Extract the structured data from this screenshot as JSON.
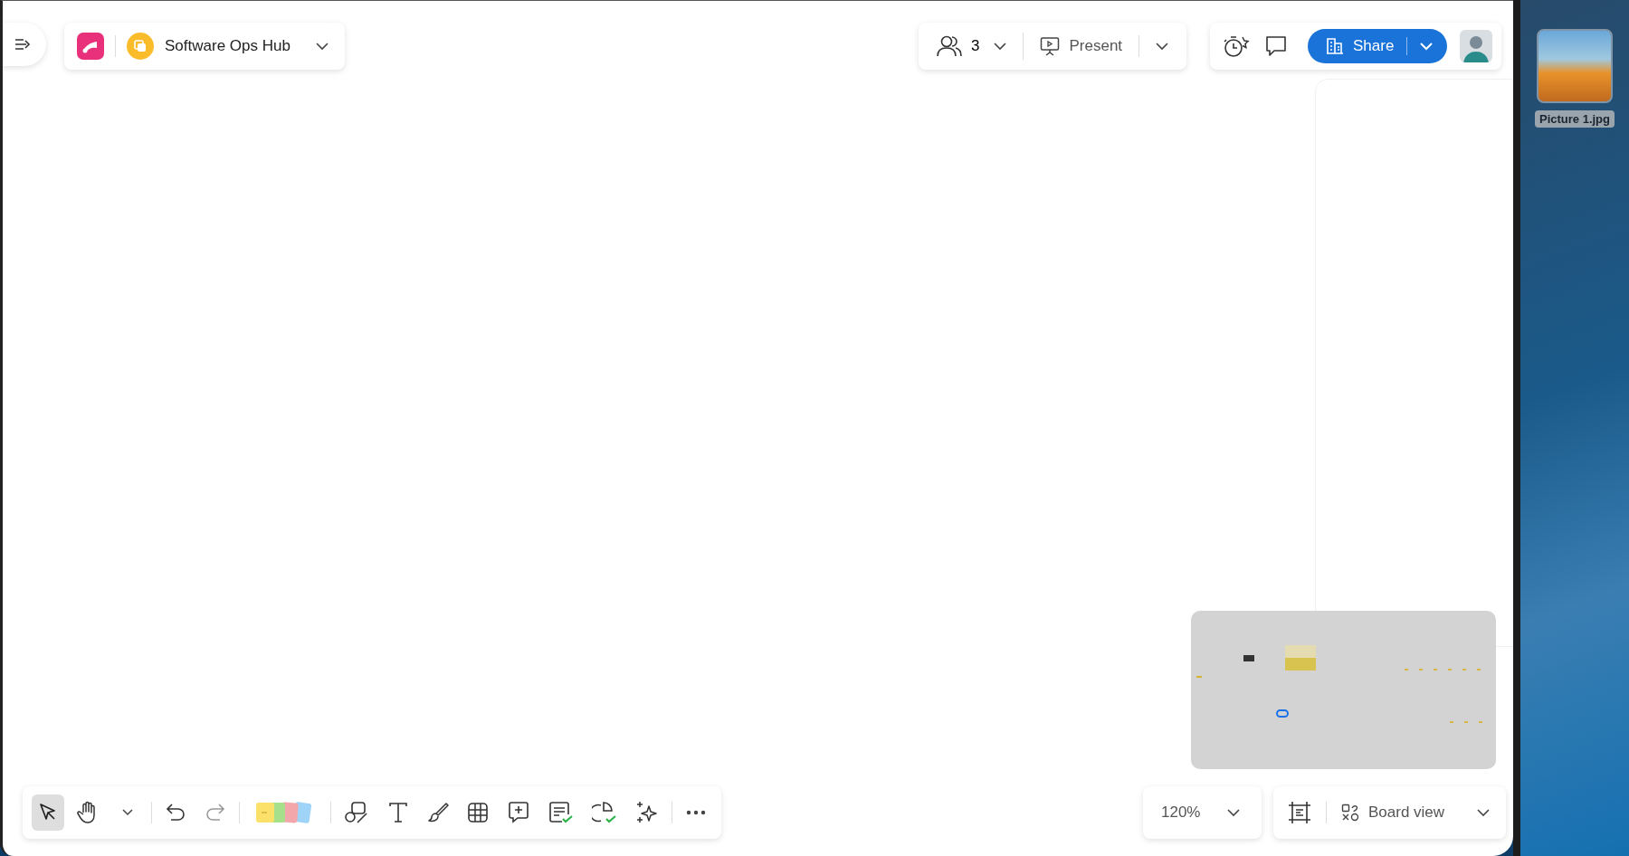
{
  "board": {
    "title": "Software Ops Hub"
  },
  "collaborators": {
    "count": "3"
  },
  "present": {
    "label": "Present"
  },
  "share": {
    "label": "Share"
  },
  "tools": [
    {
      "kind": "select",
      "selected": true
    },
    {
      "kind": "hand",
      "selected": false
    },
    {
      "kind": "caret",
      "selected": false
    },
    {
      "kind": "undo",
      "selected": false
    },
    {
      "kind": "redo",
      "selected": false
    },
    {
      "kind": "sticky",
      "selected": false
    },
    {
      "kind": "shapes",
      "selected": false
    },
    {
      "kind": "text",
      "selected": false
    },
    {
      "kind": "pen",
      "selected": false
    },
    {
      "kind": "table",
      "selected": false
    },
    {
      "kind": "comment",
      "selected": false
    },
    {
      "kind": "card",
      "selected": false
    },
    {
      "kind": "diagram",
      "selected": false
    },
    {
      "kind": "ai",
      "selected": false
    },
    {
      "kind": "more",
      "selected": false
    }
  ],
  "zoom": {
    "value": "120%"
  },
  "view": {
    "label": "Board view"
  },
  "desktop": {
    "file": {
      "name": "Picture 1.jpg"
    }
  }
}
